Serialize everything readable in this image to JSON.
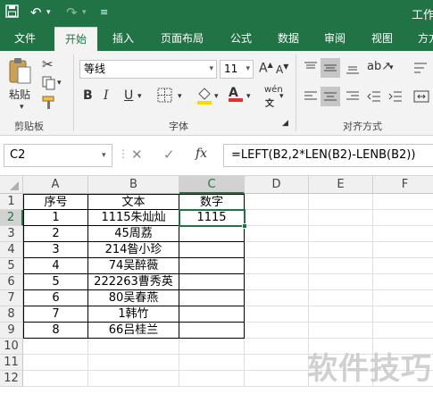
{
  "window": {
    "title": "工作"
  },
  "ribbon_tabs": [
    "文件",
    "开始",
    "插入",
    "页面布局",
    "公式",
    "数据",
    "审阅",
    "视图",
    "方方"
  ],
  "active_tab": "开始",
  "clipboard": {
    "paste_label": "粘贴",
    "group_label": "剪贴板"
  },
  "font": {
    "name": "等线",
    "size": "11",
    "bold": "B",
    "italic": "I",
    "underline": "U",
    "phonetic": "wén",
    "group_label": "字体"
  },
  "alignment": {
    "group_label": "对齐方式"
  },
  "formula_bar": {
    "name_box": "C2",
    "fx": "fx",
    "cancel": "✕",
    "confirm": "✓",
    "formula": "=LEFT(B2,2*LEN(B2)-LENB(B2))"
  },
  "sheet": {
    "columns": [
      "A",
      "B",
      "C",
      "D",
      "E",
      "F"
    ],
    "rows": [
      "1",
      "2",
      "3",
      "4",
      "5",
      "6",
      "7",
      "8",
      "9",
      "10",
      "11",
      "12"
    ],
    "headers": [
      "序号",
      "文本",
      "数字"
    ],
    "data": [
      [
        "1",
        "1115朱灿灿",
        "1115"
      ],
      [
        "2",
        "45周荔",
        ""
      ],
      [
        "3",
        "214昝小珍",
        ""
      ],
      [
        "4",
        "74吴醉薇",
        ""
      ],
      [
        "5",
        "222263曹秀英",
        ""
      ],
      [
        "6",
        "80吴春燕",
        ""
      ],
      [
        "7",
        "1韩竹",
        ""
      ],
      [
        "8",
        "66吕桂兰",
        ""
      ]
    ],
    "selected_cell": "C2"
  },
  "watermark": "软件技巧",
  "colors": {
    "brand": "#217346",
    "ribbon_bg": "#f3f3f3",
    "font_color": "#e03030",
    "fill_color": "#ffd700"
  }
}
